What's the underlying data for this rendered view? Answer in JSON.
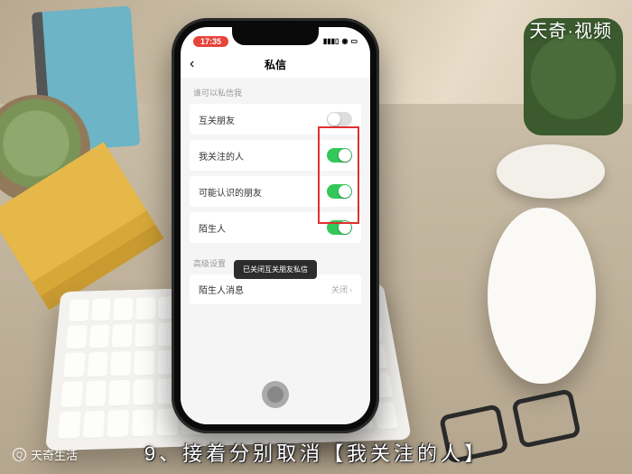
{
  "overlay": {
    "brand_top_right": "天奇·视频",
    "brand_bottom_left": "天奇生活",
    "caption": "9、接着分别取消【我关注的人】"
  },
  "status": {
    "time": "17:35",
    "signal_text": "::!! 令"
  },
  "nav": {
    "title": "私信"
  },
  "sections": {
    "who_can_dm": "谁可以私信我",
    "advanced": "高级设置"
  },
  "rows": {
    "mutual_friends": {
      "label": "互关朋友",
      "on": false
    },
    "following": {
      "label": "我关注的人",
      "on": true
    },
    "maybe_known": {
      "label": "可能认识的朋友",
      "on": true
    },
    "strangers": {
      "label": "陌生人",
      "on": true
    },
    "stranger_msg": {
      "label": "陌生人消息",
      "value_prefix": "",
      "value": "关闭"
    }
  },
  "toast": "已关闭互关朋友私信"
}
